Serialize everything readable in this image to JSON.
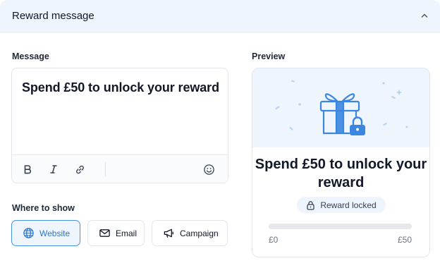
{
  "header": {
    "title": "Reward message",
    "collapse_icon": "chevron-up-icon"
  },
  "message": {
    "label": "Message",
    "text": "Spend £50 to unlock your reward",
    "toolbar": [
      {
        "name": "bold-button",
        "icon": "bold-icon"
      },
      {
        "name": "italic-button",
        "icon": "italic-icon"
      },
      {
        "name": "link-button",
        "icon": "link-icon"
      },
      {
        "name": "emoji-button",
        "icon": "emoji-icon"
      }
    ]
  },
  "where": {
    "label": "Where to show",
    "options": [
      {
        "label": "Website",
        "icon": "globe-icon",
        "selected": true
      },
      {
        "label": "Email",
        "icon": "mail-icon",
        "selected": false
      },
      {
        "label": "Campaign",
        "icon": "megaphone-icon",
        "selected": false
      }
    ]
  },
  "preview": {
    "label": "Preview",
    "illustration": "gift-lock-icon",
    "title": "Spend £50 to unlock your reward",
    "badge": "Reward locked",
    "badge_icon": "lock-icon",
    "progress": {
      "fraction": 0,
      "min_label": "£0",
      "max_label": "£50"
    }
  },
  "colors": {
    "accent": "#4a90e2",
    "header_bg": "#eef5fd",
    "active_text": "#2f75c9"
  }
}
